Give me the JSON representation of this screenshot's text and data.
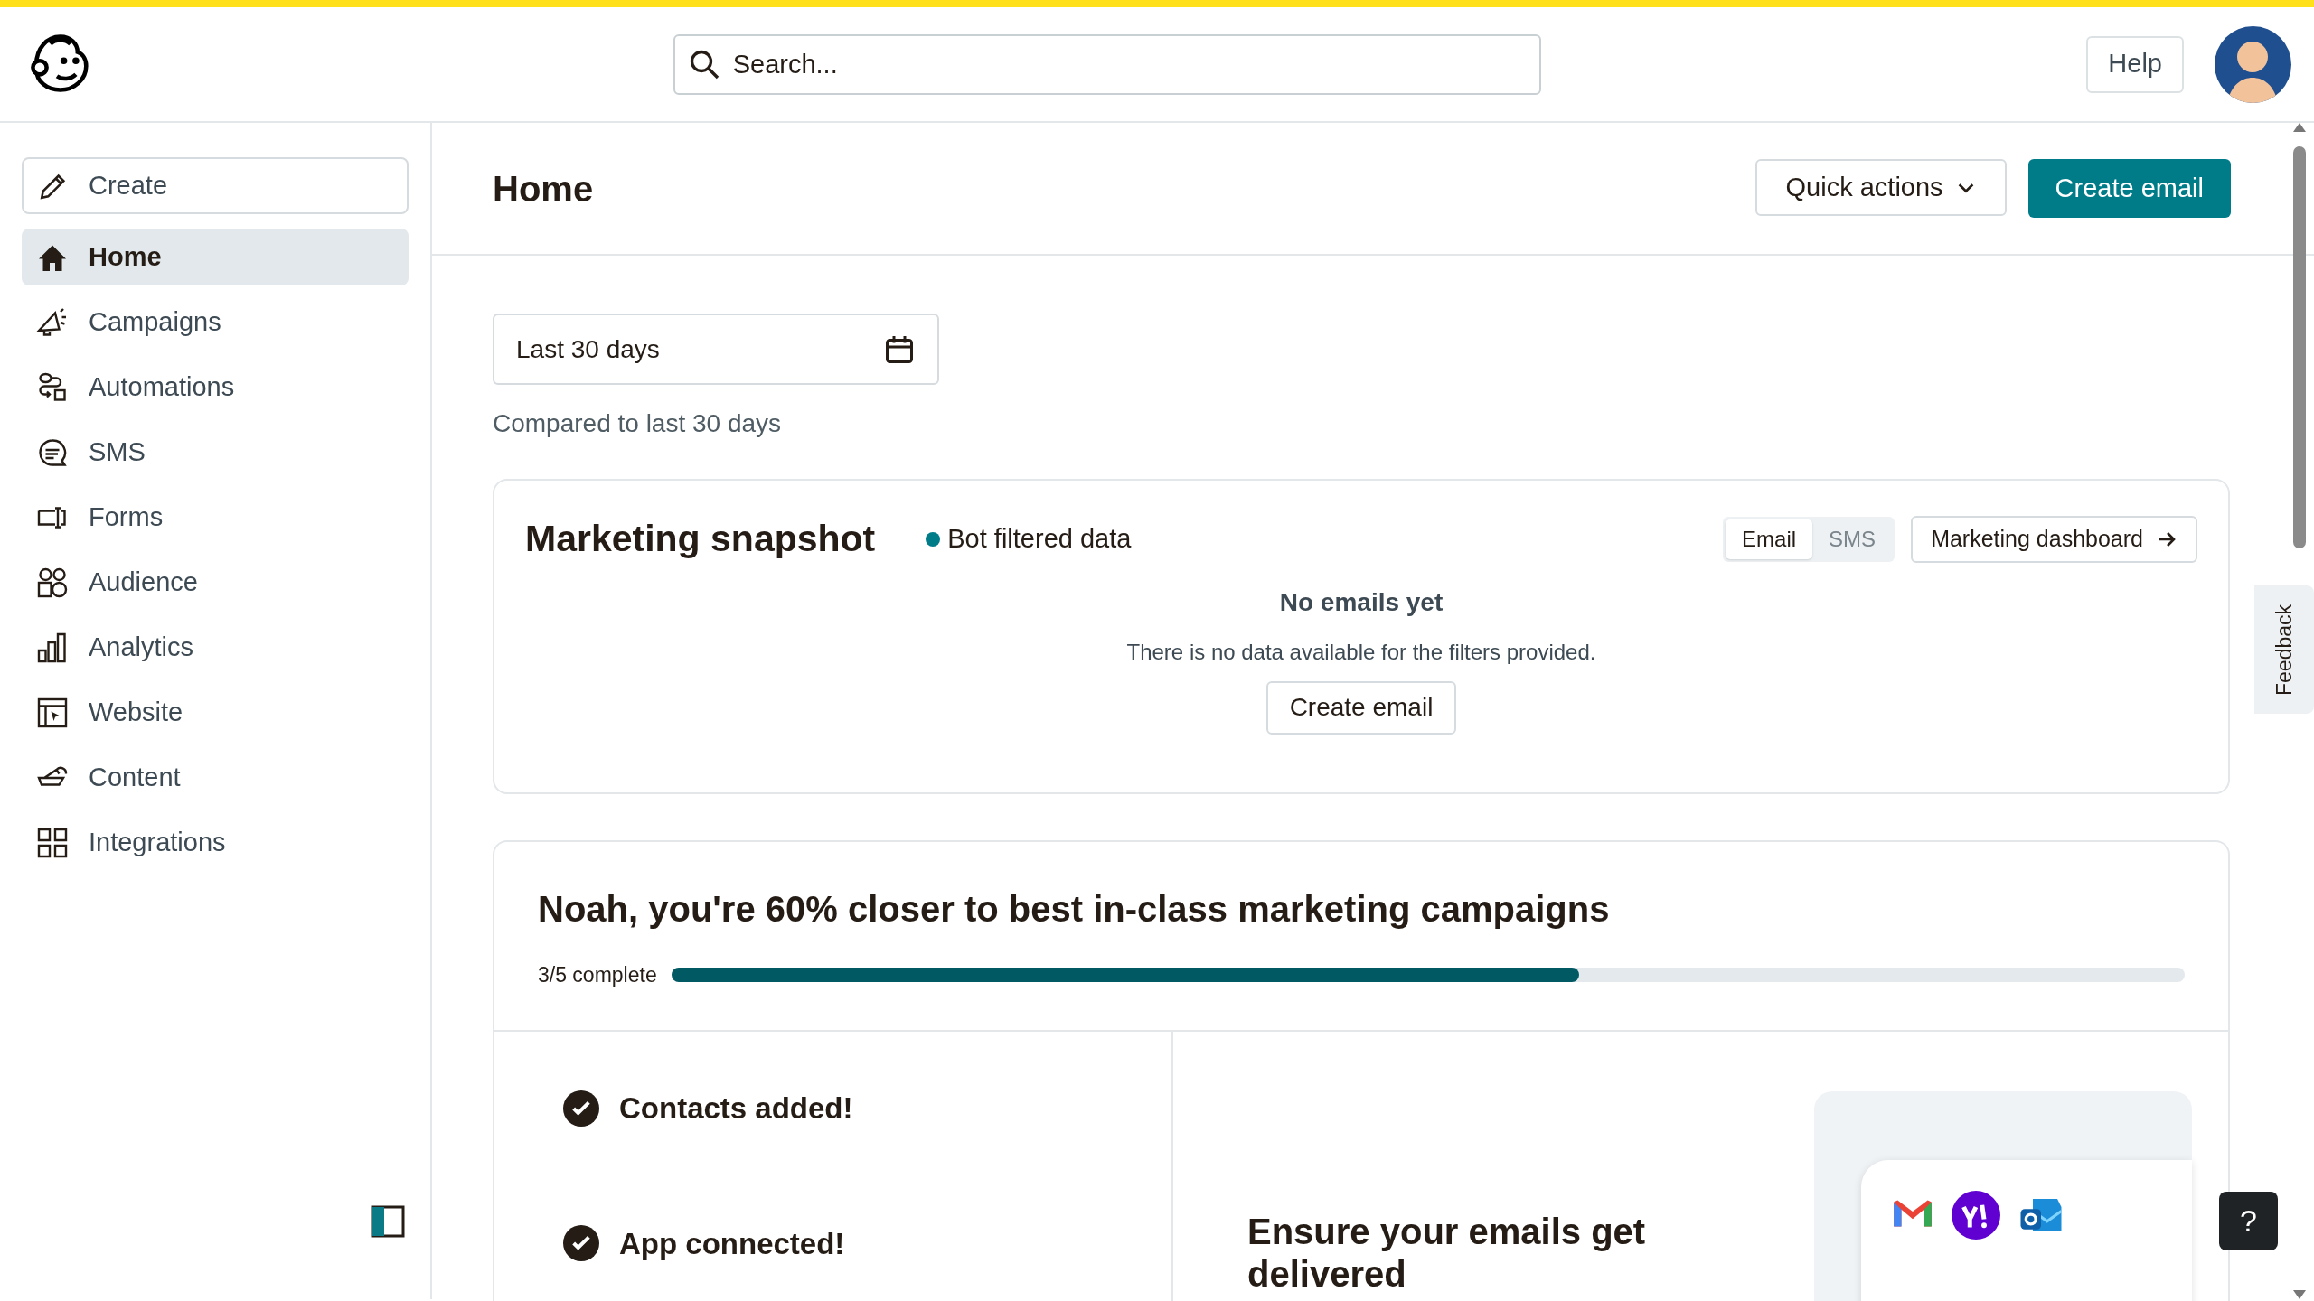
{
  "header": {
    "search": {
      "placeholder": "Search..."
    },
    "help": "Help"
  },
  "sidebar": {
    "create": "Create",
    "items": [
      {
        "label": "Home",
        "selected": true
      },
      {
        "label": "Campaigns",
        "selected": false
      },
      {
        "label": "Automations",
        "selected": false
      },
      {
        "label": "SMS",
        "selected": false
      },
      {
        "label": "Forms",
        "selected": false
      },
      {
        "label": "Audience",
        "selected": false
      },
      {
        "label": "Analytics",
        "selected": false
      },
      {
        "label": "Website",
        "selected": false
      },
      {
        "label": "Content",
        "selected": false
      },
      {
        "label": "Integrations",
        "selected": false
      }
    ]
  },
  "page": {
    "title": "Home",
    "quick_actions": "Quick actions",
    "create_email": "Create email"
  },
  "date_filter": {
    "value": "Last 30 days",
    "comparison": "Compared to last 30 days"
  },
  "snapshot": {
    "title": "Marketing snapshot",
    "filter_badge": "Bot filtered data",
    "channels": [
      {
        "label": "Email",
        "selected": true
      },
      {
        "label": "SMS",
        "selected": false
      }
    ],
    "dashboard_link": "Marketing dashboard",
    "empty_title": "No emails yet",
    "empty_text": "There is no data available for the filters provided.",
    "empty_action": "Create email"
  },
  "progress": {
    "title": "Noah, you're 60% closer to best in-class marketing campaigns",
    "count": "3/5 complete",
    "level": 0.6,
    "steps": [
      {
        "label": "Contacts added!",
        "done": true
      },
      {
        "label": "App connected!",
        "done": true
      }
    ],
    "feature_title": "Ensure your emails get delivered"
  },
  "feedback": "Feedback",
  "help_fab": "?"
}
